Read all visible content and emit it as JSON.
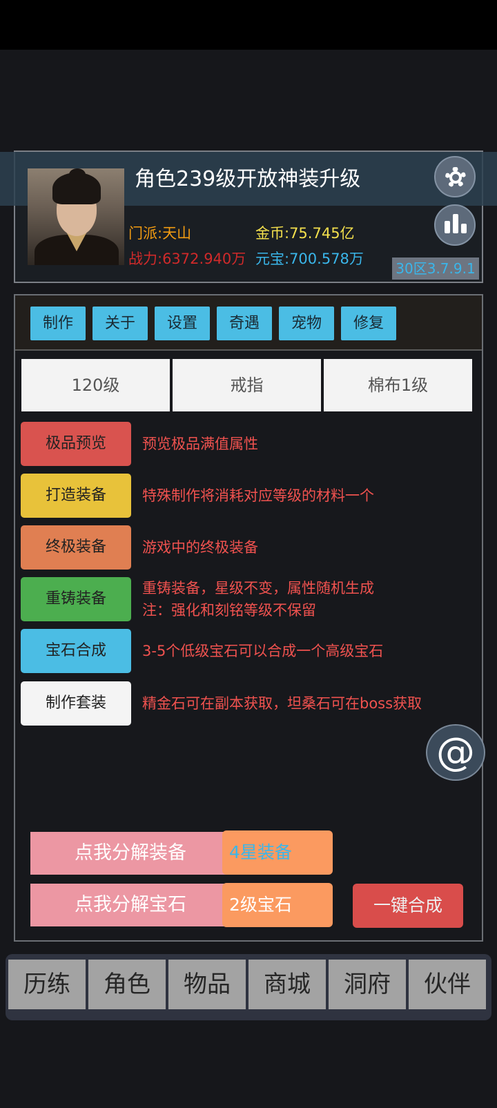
{
  "notice": {
    "text": "角色239级开放神装升级"
  },
  "player": {
    "sect": "门派:天山",
    "gold": "金币:75.745亿",
    "power": "战力:6372.940万",
    "yuanbao": "元宝:700.578万",
    "server": "30区3.7.9.1"
  },
  "icons": {
    "settings": "gear-icon",
    "stats": "bar-chart-icon",
    "mention": "at-icon"
  },
  "tabs": [
    "制作",
    "关于",
    "设置",
    "奇遇",
    "宠物",
    "修复"
  ],
  "segments": [
    "120级",
    "戒指",
    "棉布1级"
  ],
  "actions": [
    {
      "label": "极品预览",
      "desc": "预览极品满值属性",
      "color": "#d9534f"
    },
    {
      "label": "打造装备",
      "desc": "特殊制作将消耗对应等级的材料一个",
      "color": "#e8c23a"
    },
    {
      "label": "终极装备",
      "desc": "游戏中的终极装备",
      "color": "#e07f52"
    },
    {
      "label": "重铸装备",
      "desc": "重铸装备，星级不变，属性随机生成",
      "desc2": "注：强化和刻铭等级不保留",
      "color": "#4cae4f"
    },
    {
      "label": "宝石合成",
      "desc": "3-5个低级宝石可以合成一个高级宝石",
      "color": "#4bbde4"
    },
    {
      "label": "制作套装",
      "desc": "精金石可在副本获取，坦桑石可在boss获取",
      "color": "#f4f4f4"
    }
  ],
  "decompose": {
    "equip_label": "点我分解装备",
    "equip_select": "4星装备",
    "gem_label": "点我分解宝石",
    "gem_select": "2级宝石",
    "onekey": "一键合成"
  },
  "nav": [
    "历练",
    "角色",
    "物品",
    "商城",
    "洞府",
    "伙伴"
  ]
}
